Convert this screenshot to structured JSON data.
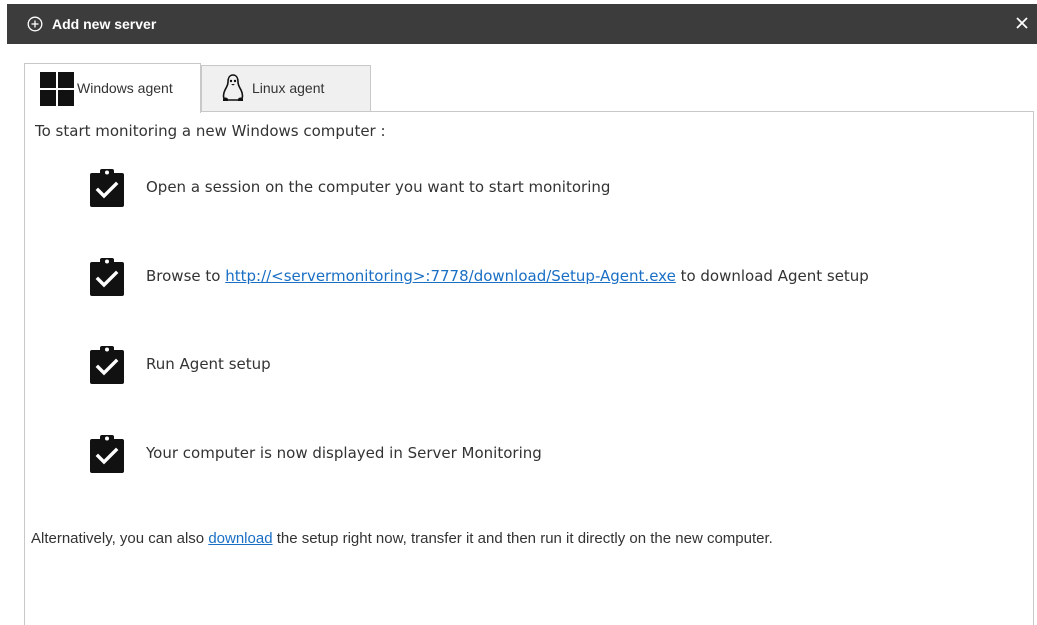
{
  "dialog": {
    "title": "Add new server",
    "title_icon": "add-circle-icon",
    "close_icon": "close-icon"
  },
  "tabs": [
    {
      "label": "Windows agent",
      "icon": "windows-logo-icon",
      "active": true
    },
    {
      "label": "Linux agent",
      "icon": "linux-penguin-icon",
      "active": false
    }
  ],
  "panel": {
    "intro": "To start monitoring a new Windows computer :",
    "steps": [
      {
        "icon": "clipboard-check-icon",
        "text": "Open a session on the computer you want to start monitoring"
      },
      {
        "icon": "clipboard-check-icon",
        "text_before": "Browse to ",
        "link": "http://<servermonitoring>:7778/download/Setup-Agent.exe",
        "text_after": " to download Agent setup"
      },
      {
        "icon": "clipboard-check-icon",
        "text": "Run Agent setup"
      },
      {
        "icon": "clipboard-check-icon",
        "text": "Your computer is now displayed in Server Monitoring"
      }
    ],
    "footer": {
      "text_before": "Alternatively, you can also ",
      "link": "download",
      "text_after": " the setup right now, transfer it and then run it directly on the new computer."
    }
  },
  "colors": {
    "titlebar": "#3c3c3c",
    "link": "#1a6fc4",
    "icon": "#111111",
    "border": "#c8c8c8"
  }
}
